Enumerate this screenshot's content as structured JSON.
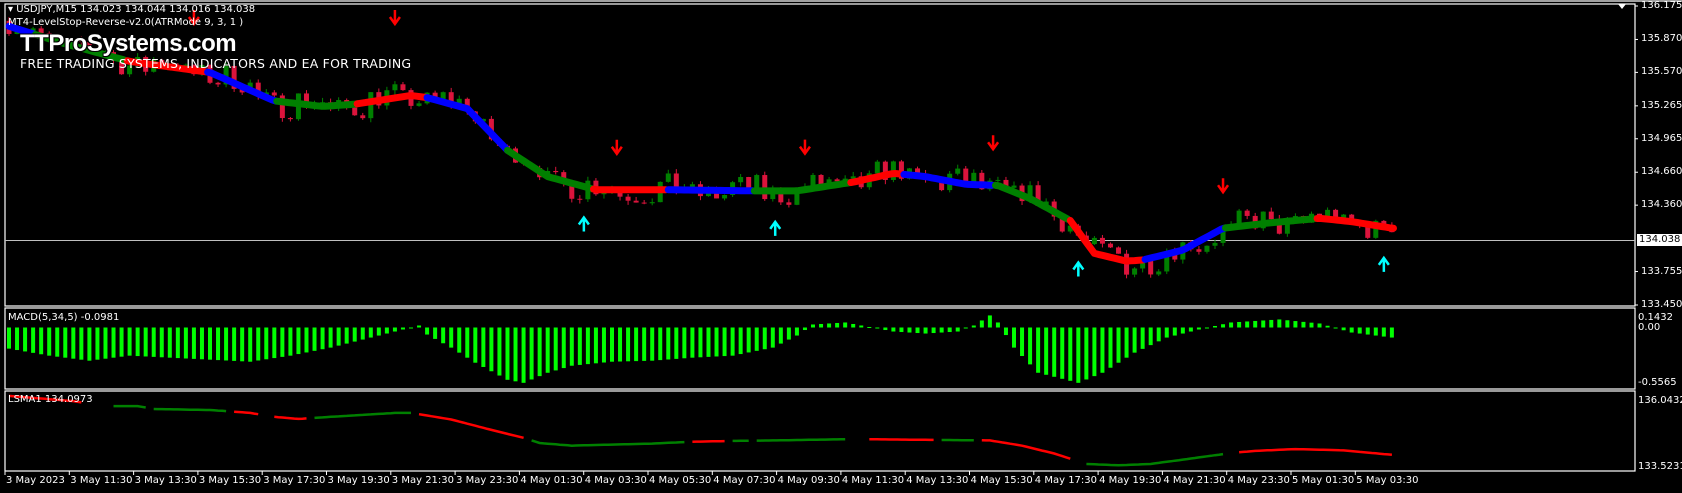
{
  "header": {
    "symbol_line": "USDJPY,M15  134.023 134.044 134.016 134.038",
    "indicator_line": "MT4-LevelStop-Reverse-v2.0(ATRMode 9, 3, 1 )",
    "macd_label": "MACD(5,34,5) -0.0981",
    "lsma_label": "LSMA1 134.0973"
  },
  "watermark": {
    "logo": "TTProSystems.com",
    "tagline": "FREE TRADING SYSTEMS, INDICATORS AND EA FOR TRADING"
  },
  "colors": {
    "bull": "#008000",
    "bear": "#DC143C",
    "line_green": "#008000",
    "line_red": "#FF0000",
    "line_blue": "#0000FF",
    "arrow_down": "#FF0000",
    "arrow_up": "#00FFFF",
    "macd": "#00FF00"
  },
  "chart_data": [
    {
      "type": "candlestick",
      "title": "USDJPY,M15",
      "ylim": [
        133.45,
        136.175
      ],
      "y_ticks": [
        "136.175",
        "135.870",
        "135.570",
        "135.265",
        "134.965",
        "134.660",
        "134.360",
        "133.755",
        "133.450"
      ],
      "current_price": "134.038",
      "x_ticks": [
        "3 May 2023",
        "3 May 11:30",
        "3 May 13:30",
        "3 May 15:30",
        "3 May 17:30",
        "3 May 19:30",
        "3 May 21:30",
        "3 May 23:30",
        "4 May 01:30",
        "4 May 03:30",
        "4 May 05:30",
        "4 May 07:30",
        "4 May 09:30",
        "4 May 11:30",
        "4 May 13:30",
        "4 May 15:30",
        "4 May 17:30",
        "4 May 19:30",
        "4 May 21:30",
        "4 May 23:30",
        "5 May 01:30",
        "5 May 03:30"
      ],
      "bars_total": 173,
      "levelstop_line": [
        [
          0,
          135.99
        ],
        [
          7,
          135.83
        ],
        [
          15,
          135.67
        ],
        [
          25,
          135.57
        ],
        [
          33,
          135.31
        ],
        [
          39,
          135.26
        ],
        [
          43,
          135.28
        ],
        [
          50,
          135.36
        ],
        [
          52,
          135.34
        ],
        [
          57,
          135.24
        ],
        [
          62,
          134.86
        ],
        [
          67,
          134.62
        ],
        [
          73,
          134.5
        ],
        [
          82,
          134.5
        ],
        [
          93,
          134.49
        ],
        [
          98,
          134.49
        ],
        [
          105,
          134.57
        ],
        [
          110,
          134.65
        ],
        [
          114,
          134.62
        ],
        [
          119,
          134.55
        ],
        [
          123,
          134.54
        ],
        [
          127,
          134.42
        ],
        [
          132,
          134.22
        ],
        [
          135,
          133.92
        ],
        [
          139,
          133.85
        ],
        [
          141,
          133.86
        ],
        [
          146,
          133.95
        ],
        [
          151,
          134.15
        ],
        [
          157,
          134.2
        ],
        [
          163,
          134.24
        ],
        [
          167,
          134.21
        ],
        [
          172,
          134.15
        ]
      ],
      "levelstop_segments": [
        [
          0,
          3.3,
          "blue"
        ],
        [
          3.3,
          14.7,
          "green"
        ],
        [
          14.7,
          24.7,
          "red"
        ],
        [
          24.7,
          33.3,
          "blue"
        ],
        [
          33.3,
          43.3,
          "green"
        ],
        [
          43.3,
          52,
          "red"
        ],
        [
          52,
          62,
          "blue"
        ],
        [
          62,
          72.7,
          "green"
        ],
        [
          72.7,
          82,
          "red"
        ],
        [
          82,
          92.7,
          "blue"
        ],
        [
          92.7,
          104.7,
          "green"
        ],
        [
          104.7,
          111.3,
          "red"
        ],
        [
          111.3,
          122.7,
          "blue"
        ],
        [
          122.7,
          132,
          "green"
        ],
        [
          132,
          141.3,
          "red"
        ],
        [
          141.3,
          151.3,
          "blue"
        ],
        [
          151.3,
          162.7,
          "green"
        ],
        [
          162.7,
          172.4,
          "red"
        ]
      ],
      "sell_arrows": [
        23,
        48,
        75.6,
        99,
        122.4,
        151
      ],
      "buy_arrows": [
        71.5,
        95.3,
        133,
        171
      ]
    },
    {
      "type": "bar",
      "title": "MACD(5,34,5) -0.0981",
      "ylim": [
        -0.5565,
        0.1432
      ],
      "y_ticks": [
        "0.1432",
        "0.00",
        "-0.5565"
      ],
      "anchors": [
        [
          0,
          -0.21
        ],
        [
          5,
          -0.28
        ],
        [
          10,
          -0.33
        ],
        [
          15,
          -0.28
        ],
        [
          20,
          -0.3
        ],
        [
          25,
          -0.32
        ],
        [
          30,
          -0.34
        ],
        [
          35,
          -0.28
        ],
        [
          40,
          -0.2
        ],
        [
          44,
          -0.12
        ],
        [
          48,
          -0.04
        ],
        [
          50,
          0.0
        ],
        [
          51,
          0.02
        ],
        [
          52,
          -0.07
        ],
        [
          55,
          -0.2
        ],
        [
          58,
          -0.35
        ],
        [
          62,
          -0.52
        ],
        [
          64,
          -0.55
        ],
        [
          67,
          -0.45
        ],
        [
          70,
          -0.38
        ],
        [
          75,
          -0.34
        ],
        [
          80,
          -0.33
        ],
        [
          85,
          -0.3
        ],
        [
          90,
          -0.28
        ],
        [
          95,
          -0.2
        ],
        [
          98,
          -0.08
        ],
        [
          100,
          0.03
        ],
        [
          104,
          0.05
        ],
        [
          106,
          0.02
        ],
        [
          110,
          -0.04
        ],
        [
          114,
          -0.06
        ],
        [
          118,
          -0.04
        ],
        [
          120,
          0.02
        ],
        [
          122,
          0.12
        ],
        [
          123,
          0.05
        ],
        [
          125,
          -0.2
        ],
        [
          128,
          -0.45
        ],
        [
          133,
          -0.55
        ],
        [
          136,
          -0.45
        ],
        [
          140,
          -0.25
        ],
        [
          144,
          -0.1
        ],
        [
          148,
          -0.02
        ],
        [
          152,
          0.05
        ],
        [
          158,
          0.08
        ],
        [
          163,
          0.04
        ],
        [
          167,
          -0.05
        ],
        [
          172,
          -0.1
        ]
      ]
    },
    {
      "type": "line",
      "title": "LSMA1 134.0973",
      "ylim": [
        133.5231,
        136.0432
      ],
      "y_ticks": [
        "136.0432",
        "133.5231"
      ],
      "anchors": [
        [
          0,
          136.2
        ],
        [
          8,
          136.0
        ],
        [
          12,
          135.81
        ],
        [
          16,
          135.81
        ],
        [
          18,
          135.7
        ],
        [
          25,
          135.66
        ],
        [
          27,
          135.62
        ],
        [
          30,
          135.55
        ],
        [
          33,
          135.4
        ],
        [
          36,
          135.32
        ],
        [
          40,
          135.4
        ],
        [
          48,
          135.55
        ],
        [
          50,
          135.55
        ],
        [
          55,
          135.3
        ],
        [
          60,
          134.9
        ],
        [
          64,
          134.6
        ],
        [
          66,
          134.4
        ],
        [
          70,
          134.3
        ],
        [
          80,
          134.38
        ],
        [
          85,
          134.45
        ],
        [
          90,
          134.48
        ],
        [
          95,
          134.5
        ],
        [
          105,
          134.55
        ],
        [
          115,
          134.52
        ],
        [
          122,
          134.5
        ],
        [
          126,
          134.3
        ],
        [
          130,
          134.0
        ],
        [
          134,
          133.6
        ],
        [
          138,
          133.55
        ],
        [
          142,
          133.6
        ],
        [
          148,
          133.85
        ],
        [
          152,
          134.02
        ],
        [
          155,
          134.1
        ],
        [
          160,
          134.17
        ],
        [
          166,
          134.12
        ],
        [
          172,
          133.95
        ]
      ],
      "segments": [
        [
          0,
          9,
          "red"
        ],
        [
          13,
          17,
          "green"
        ],
        [
          18,
          27,
          "green"
        ],
        [
          28,
          31,
          "red"
        ],
        [
          33,
          37,
          "red"
        ],
        [
          38,
          50,
          "green"
        ],
        [
          51,
          64,
          "red"
        ],
        [
          65,
          84,
          "green"
        ],
        [
          85,
          89,
          "red"
        ],
        [
          90,
          92,
          "green"
        ],
        [
          93,
          104,
          "green"
        ],
        [
          107,
          115,
          "red"
        ],
        [
          116,
          120,
          "green"
        ],
        [
          121,
          132,
          "red"
        ],
        [
          134,
          151,
          "green"
        ],
        [
          153,
          172,
          "red"
        ]
      ]
    }
  ]
}
